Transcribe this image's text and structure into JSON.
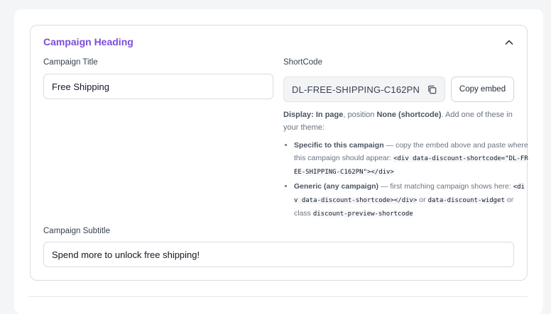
{
  "campaign": {
    "heading": "Campaign Heading",
    "title_label": "Campaign Title",
    "title_value": "Free Shipping",
    "shortcode_label": "ShortCode",
    "shortcode_value": "DL-FREE-SHIPPING-C162PN",
    "copy_embed_label": "Copy embed",
    "subtitle_label": "Campaign Subtitle",
    "subtitle_value": "Spend more to unlock free shipping!"
  },
  "display": {
    "prefix": "Display:",
    "mode": "In page",
    "position_text": ", position",
    "position_value": "None (shortcode)",
    "suffix": ". Add one of these in your theme:"
  },
  "bullets": {
    "specific_title": "Specific to this campaign",
    "specific_text": " — copy the embed above and paste where this campaign should appear: ",
    "specific_code": "<div data-discount-shortcode=\"DL-FREE-SHIPPING-C162PN\"></div>",
    "generic_title": "Generic (any campaign)",
    "generic_text": " — first matching campaign shows here: ",
    "generic_code1": "<div data-discount-shortcode></div>",
    "generic_or": " or ",
    "generic_code2": "data-discount-widget",
    "generic_class": " or class ",
    "generic_code3": "discount-preview-shortcode"
  },
  "icons": {
    "collapse": "chevron-up-icon",
    "copy": "copy-icon"
  },
  "colors": {
    "accent": "#7c4ddb",
    "border": "#d9dce1"
  }
}
